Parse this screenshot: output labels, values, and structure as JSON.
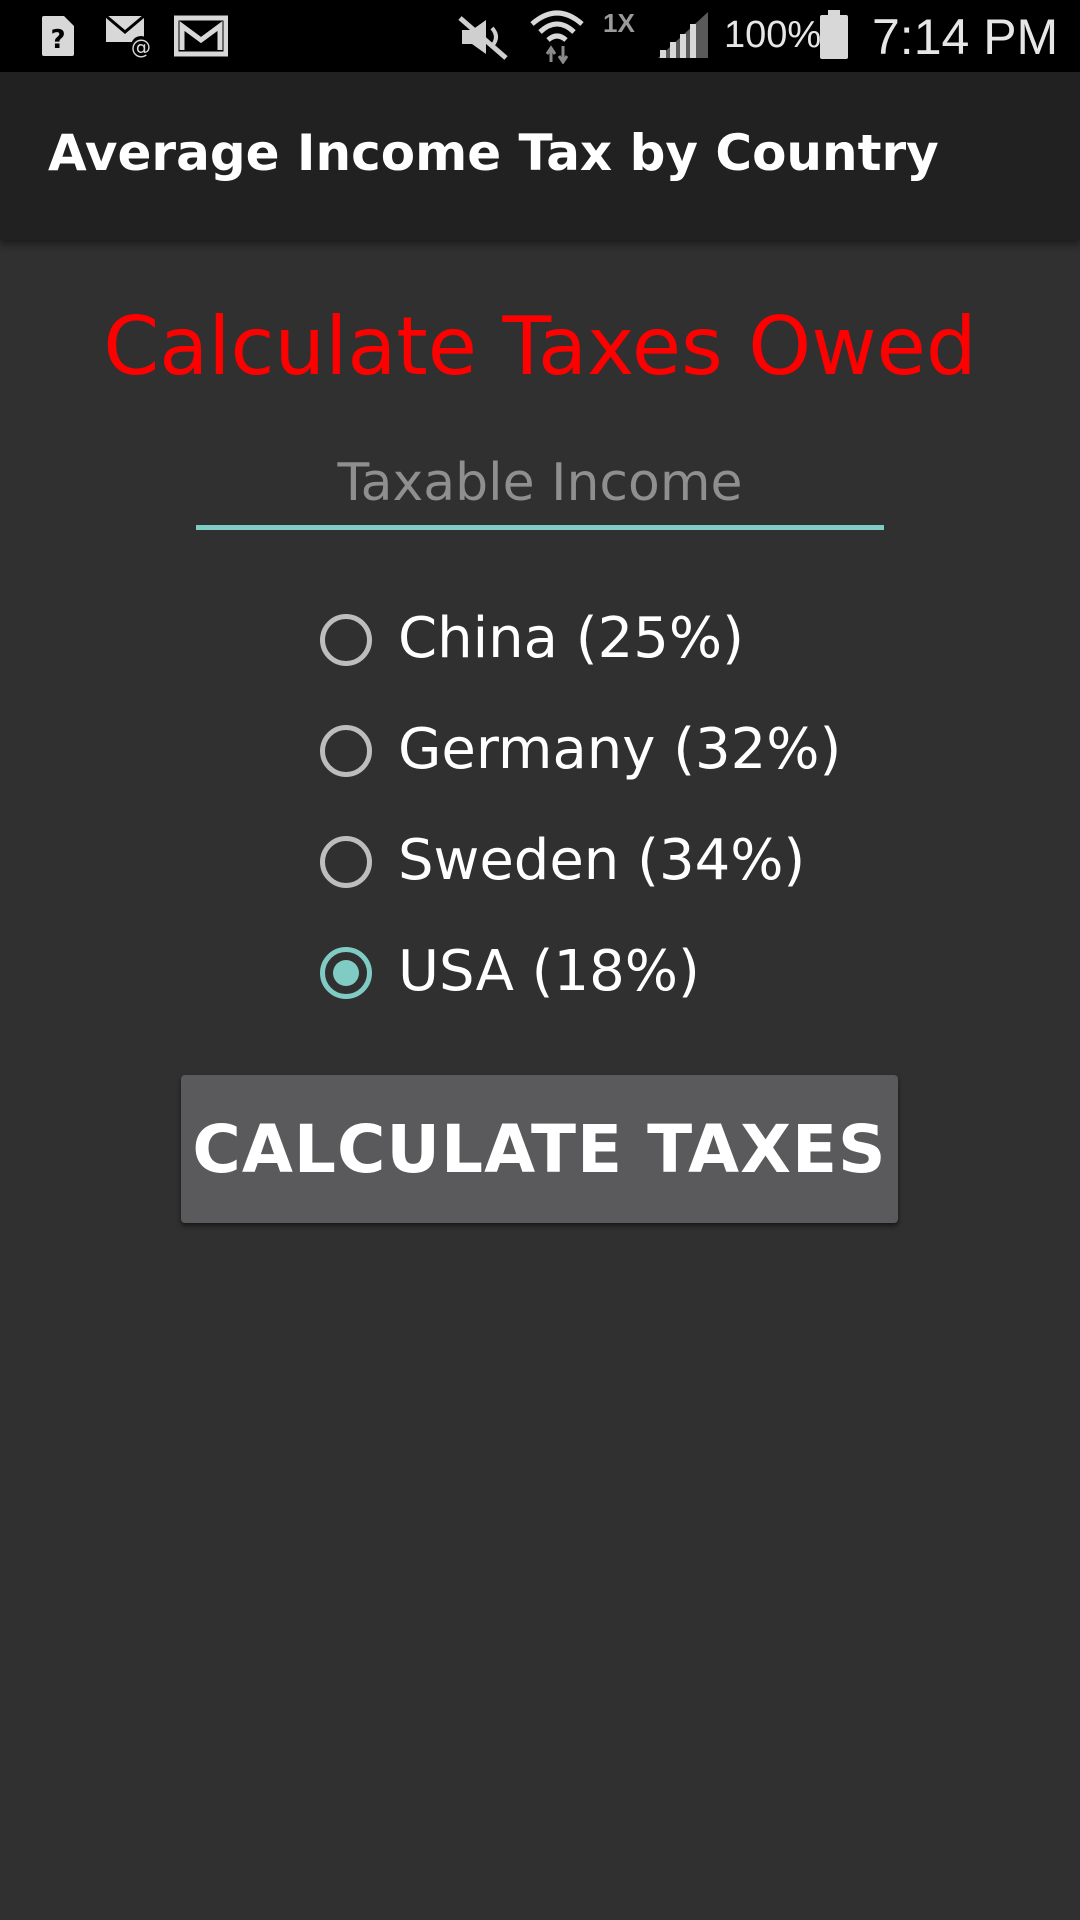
{
  "status_bar": {
    "icons": [
      "help-icon",
      "email-at-icon",
      "gmail-icon",
      "mute-icon",
      "wifi-icon",
      "signal-icon",
      "battery-icon"
    ],
    "network_type": "1X",
    "battery_percent": "100%",
    "time": "7:14 PM"
  },
  "app": {
    "title": "Average Income Tax by Country"
  },
  "form": {
    "heading": "Calculate Taxes Owed",
    "heading_color": "#ff0000",
    "income_placeholder": "Taxable Income",
    "income_value": "",
    "countries": [
      {
        "label": "China (25%)",
        "checked": false
      },
      {
        "label": "Germany (32%)",
        "checked": false
      },
      {
        "label": "Sweden (34%)",
        "checked": false
      },
      {
        "label": "USA (18%)",
        "checked": true
      }
    ],
    "button_label": "CALCULATE TAXES",
    "accent_color": "#80cbc4"
  }
}
